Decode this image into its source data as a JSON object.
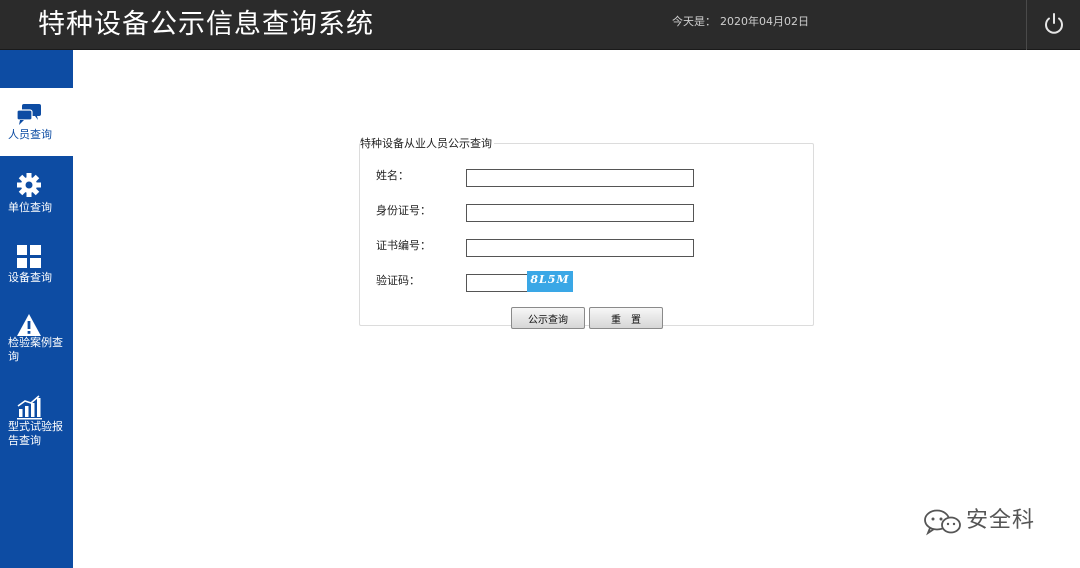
{
  "header": {
    "title": "特种设备公示信息查询系统",
    "date_label": "今天是：",
    "date_value": "2020年04月02日",
    "power_icon": "power-icon"
  },
  "sidebar": {
    "items": [
      {
        "label": "人员查询",
        "icon": "chat-bubbles-icon",
        "active": true
      },
      {
        "label": "单位查询",
        "icon": "gear-icon",
        "active": false
      },
      {
        "label": "设备查询",
        "icon": "cross-grid-icon",
        "active": false
      },
      {
        "label": "检验案例查询",
        "icon": "warning-icon",
        "active": false
      },
      {
        "label": "型式试验报告查询",
        "icon": "bar-chart-icon",
        "active": false
      }
    ]
  },
  "form": {
    "legend": "特种设备从业人员公示查询",
    "name_label": "姓名：",
    "name_value": "",
    "id_label": "身份证号：",
    "id_value": "",
    "cert_label": "证书编号：",
    "cert_value": "",
    "captcha_label": "验证码：",
    "captcha_value": "",
    "captcha_text": "8L5M",
    "query_button": "公示查询",
    "reset_button": "重　置"
  },
  "watermark": {
    "text": "安全科",
    "icon": "wechat-icon"
  },
  "colors": {
    "topbar": "#2b2b2b",
    "sidebar": "#0d4ca3",
    "captcha_bg": "#3aa7e6"
  }
}
